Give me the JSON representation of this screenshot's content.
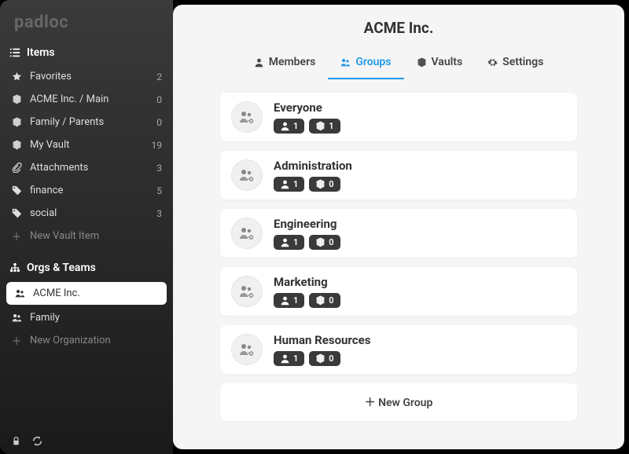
{
  "logo": "padloc",
  "sidebar": {
    "items_header": "Items",
    "items": [
      {
        "icon": "star",
        "label": "Favorites",
        "count": "2"
      },
      {
        "icon": "cube",
        "label": "ACME Inc. / Main",
        "count": "0"
      },
      {
        "icon": "cube",
        "label": "Family / Parents",
        "count": "0"
      },
      {
        "icon": "cube",
        "label": "My Vault",
        "count": "19"
      },
      {
        "icon": "clip",
        "label": "Attachments",
        "count": "3"
      },
      {
        "icon": "tag",
        "label": "finance",
        "count": "5"
      },
      {
        "icon": "tag",
        "label": "social",
        "count": "3"
      }
    ],
    "new_item": "New Vault Item",
    "orgs_header": "Orgs & Teams",
    "orgs": [
      {
        "icon": "users",
        "label": "ACME Inc.",
        "active": true
      },
      {
        "icon": "users",
        "label": "Family",
        "active": false
      }
    ],
    "new_org": "New Organization"
  },
  "main": {
    "title": "ACME Inc.",
    "tabs": [
      {
        "icon": "user",
        "label": "Members"
      },
      {
        "icon": "users",
        "label": "Groups",
        "active": true
      },
      {
        "icon": "cube",
        "label": "Vaults"
      },
      {
        "icon": "gear",
        "label": "Settings"
      }
    ],
    "groups": [
      {
        "name": "Everyone",
        "members": "1",
        "vaults": "1"
      },
      {
        "name": "Administration",
        "members": "1",
        "vaults": "0"
      },
      {
        "name": "Engineering",
        "members": "1",
        "vaults": "0"
      },
      {
        "name": "Marketing",
        "members": "1",
        "vaults": "0"
      },
      {
        "name": "Human Resources",
        "members": "1",
        "vaults": "0"
      }
    ],
    "new_group": "New Group"
  }
}
